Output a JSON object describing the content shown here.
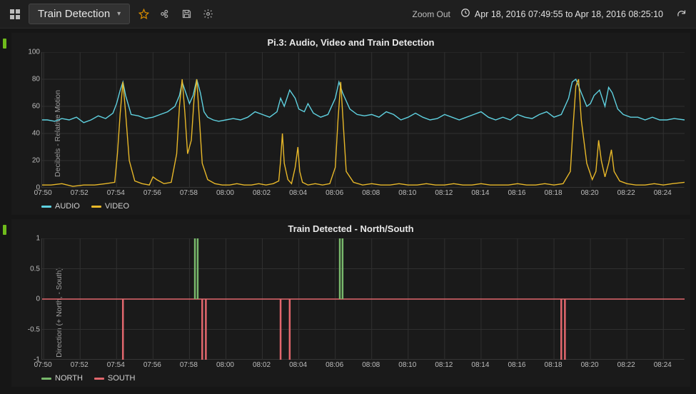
{
  "header": {
    "dash_title": "Train Detection",
    "zoom_out": "Zoom Out",
    "timerange": "Apr 18, 2016 07:49:55 to Apr 18, 2016 08:25:10"
  },
  "panel1": {
    "title": "Pi.3: Audio, Video and Train Detection",
    "ylabel": "Decibels - Relative Motion",
    "legend": {
      "audio": "AUDIO",
      "video": "VIDEO"
    }
  },
  "panel2": {
    "title": "Train Detected - North/South",
    "ylabel": "Direction (+ North, - South)",
    "legend": {
      "north": "NORTH",
      "south": "SOUTH"
    }
  },
  "colors": {
    "audio": "#5fd1e0",
    "video": "#e8b829",
    "north": "#78b86b",
    "south": "#e2676d"
  },
  "chart_data": [
    {
      "type": "line",
      "title": "Pi.3: Audio, Video and Train Detection",
      "ylabel": "Decibels - Relative Motion",
      "ylim": [
        0,
        100
      ],
      "yticks": [
        0,
        20,
        40,
        60,
        80,
        100
      ],
      "x_range_minutes": [
        469.916,
        505.166
      ],
      "xticks": [
        "07:50",
        "07:52",
        "07:54",
        "07:56",
        "07:58",
        "08:00",
        "08:02",
        "08:04",
        "08:06",
        "08:08",
        "08:10",
        "08:12",
        "08:14",
        "08:16",
        "08:18",
        "08:20",
        "08:22",
        "08:24"
      ],
      "series": [
        {
          "name": "AUDIO",
          "color": "#5fd1e0",
          "x": [
            469.916,
            470.2,
            470.6,
            471,
            471.4,
            471.8,
            472.2,
            472.6,
            473,
            473.4,
            473.8,
            474,
            474.2,
            474.35,
            474.5,
            474.8,
            475.2,
            475.6,
            476,
            476.4,
            476.8,
            477.2,
            477.45,
            477.6,
            477.8,
            478,
            478.2,
            478.4,
            478.6,
            478.8,
            479.0,
            479.3,
            479.6,
            480,
            480.4,
            480.8,
            481.2,
            481.6,
            482,
            482.4,
            482.8,
            483.0,
            483.2,
            483.5,
            483.8,
            484.0,
            484.3,
            484.5,
            484.8,
            485.2,
            485.6,
            486.0,
            486.2,
            486.4,
            486.8,
            487.2,
            487.6,
            488.0,
            488.4,
            488.8,
            489.2,
            489.6,
            490.0,
            490.4,
            490.8,
            491.2,
            491.6,
            492.0,
            492.4,
            492.8,
            493.2,
            493.6,
            494.0,
            494.4,
            494.8,
            495.2,
            495.6,
            496.0,
            496.4,
            496.8,
            497.2,
            497.6,
            498.0,
            498.4,
            498.8,
            499.0,
            499.2,
            499.5,
            499.8,
            500.0,
            500.2,
            500.5,
            500.8,
            501.0,
            501.2,
            501.5,
            501.8,
            502.2,
            502.6,
            503.0,
            503.4,
            503.8,
            504.2,
            504.6,
            505.166
          ],
          "y": [
            50,
            50,
            49,
            51,
            50,
            52,
            48,
            50,
            53,
            51,
            55,
            62,
            72,
            78,
            68,
            54,
            53,
            51,
            52,
            54,
            56,
            60,
            68,
            78,
            70,
            62,
            68,
            80,
            70,
            56,
            52,
            50,
            49,
            50,
            51,
            50,
            52,
            56,
            54,
            52,
            56,
            66,
            60,
            72,
            66,
            58,
            56,
            62,
            55,
            52,
            54,
            66,
            78,
            70,
            58,
            54,
            53,
            54,
            52,
            56,
            54,
            50,
            52,
            55,
            52,
            50,
            51,
            54,
            52,
            50,
            52,
            54,
            56,
            52,
            50,
            52,
            50,
            54,
            52,
            51,
            54,
            56,
            52,
            54,
            66,
            78,
            80,
            70,
            60,
            62,
            68,
            72,
            60,
            74,
            70,
            58,
            54,
            52,
            52,
            50,
            52,
            50,
            50,
            51,
            50
          ]
        },
        {
          "name": "VIDEO",
          "color": "#e8b829",
          "x": [
            469.916,
            470.4,
            471,
            471.6,
            472.2,
            472.8,
            473.4,
            473.9,
            474.05,
            474.2,
            474.35,
            474.5,
            474.7,
            475.0,
            475.4,
            475.8,
            476.0,
            476.2,
            476.6,
            477.0,
            477.3,
            477.45,
            477.6,
            477.75,
            477.9,
            478.1,
            478.25,
            478.4,
            478.55,
            478.7,
            479.0,
            479.4,
            479.8,
            480.2,
            480.6,
            481.0,
            481.4,
            481.8,
            482.2,
            482.6,
            482.9,
            483.0,
            483.1,
            483.2,
            483.4,
            483.6,
            483.8,
            483.95,
            484.05,
            484.2,
            484.5,
            484.9,
            485.3,
            485.7,
            486.0,
            486.15,
            486.3,
            486.45,
            486.6,
            487.0,
            487.5,
            488.0,
            488.5,
            489.0,
            489.5,
            490.0,
            490.5,
            491.0,
            491.5,
            492.0,
            492.5,
            493.0,
            493.5,
            494.0,
            494.5,
            495.0,
            495.5,
            496.0,
            496.5,
            497.0,
            497.5,
            498.0,
            498.5,
            498.9,
            499.05,
            499.2,
            499.35,
            499.5,
            499.8,
            500.1,
            500.3,
            500.45,
            500.6,
            500.8,
            501.0,
            501.15,
            501.3,
            501.6,
            502.0,
            502.5,
            503.0,
            503.5,
            504.0,
            504.5,
            505.166
          ],
          "y": [
            2,
            2,
            3,
            1,
            2,
            2,
            3,
            4,
            25,
            55,
            78,
            55,
            20,
            5,
            3,
            2,
            8,
            6,
            3,
            4,
            25,
            60,
            80,
            55,
            25,
            35,
            65,
            80,
            50,
            18,
            6,
            3,
            2,
            2,
            3,
            2,
            2,
            3,
            2,
            3,
            5,
            20,
            40,
            18,
            6,
            3,
            15,
            30,
            12,
            4,
            2,
            3,
            2,
            3,
            15,
            50,
            78,
            45,
            12,
            4,
            2,
            3,
            2,
            2,
            3,
            2,
            2,
            3,
            2,
            2,
            3,
            2,
            2,
            3,
            2,
            2,
            2,
            3,
            2,
            2,
            3,
            2,
            3,
            12,
            45,
            75,
            80,
            50,
            18,
            6,
            12,
            35,
            20,
            8,
            18,
            28,
            12,
            5,
            3,
            2,
            2,
            3,
            2,
            3,
            4
          ]
        }
      ]
    },
    {
      "type": "bar",
      "title": "Train Detected - North/South",
      "ylabel": "Direction (+ North, - South)",
      "ylim": [
        -1.0,
        1.0
      ],
      "yticks": [
        -1.0,
        -0.5,
        0,
        0.5,
        1.0
      ],
      "x_range_minutes": [
        469.916,
        505.166
      ],
      "xticks": [
        "07:50",
        "07:52",
        "07:54",
        "07:56",
        "07:58",
        "08:00",
        "08:02",
        "08:04",
        "08:06",
        "08:08",
        "08:10",
        "08:12",
        "08:14",
        "08:16",
        "08:18",
        "08:20",
        "08:22",
        "08:24"
      ],
      "events": [
        {
          "minute": 474.35,
          "dir": -1,
          "label": "SOUTH"
        },
        {
          "minute": 478.3,
          "dir": 1,
          "label": "NORTH"
        },
        {
          "minute": 478.45,
          "dir": 1,
          "label": "NORTH"
        },
        {
          "minute": 478.7,
          "dir": -1,
          "label": "SOUTH"
        },
        {
          "minute": 478.9,
          "dir": -1,
          "label": "SOUTH"
        },
        {
          "minute": 483.0,
          "dir": -1,
          "label": "SOUTH"
        },
        {
          "minute": 483.5,
          "dir": -1,
          "label": "SOUTH"
        },
        {
          "minute": 486.25,
          "dir": 1,
          "label": "NORTH"
        },
        {
          "minute": 486.4,
          "dir": 1,
          "label": "NORTH"
        },
        {
          "minute": 498.4,
          "dir": -1,
          "label": "SOUTH"
        },
        {
          "minute": 498.6,
          "dir": -1,
          "label": "SOUTH"
        }
      ]
    }
  ]
}
